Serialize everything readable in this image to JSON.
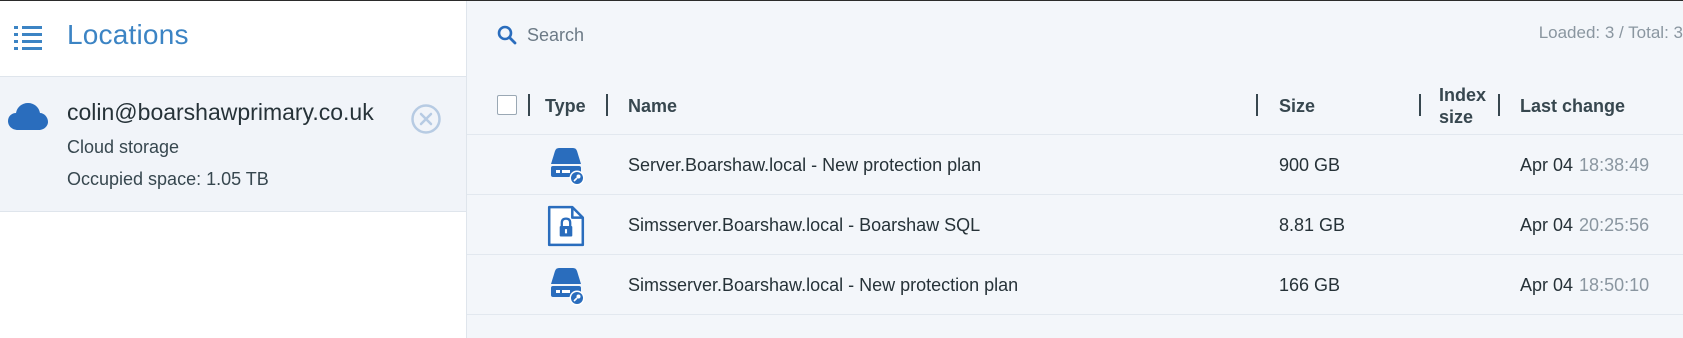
{
  "sidebar": {
    "title": "Locations",
    "menu_icon": "list-icon",
    "location": {
      "icon": "cloud-icon",
      "email": "colin@boarshawprimary.co.uk",
      "type": "Cloud storage",
      "occupied": "Occupied space: 1.05 TB",
      "remove_icon": "close-circle-icon"
    }
  },
  "toolbar": {
    "search_placeholder": "Search",
    "loaded_text": "Loaded: 3 / Total: 3"
  },
  "table": {
    "columns": {
      "type": "Type",
      "name": "Name",
      "size": "Size",
      "index_size_line1": "Index",
      "index_size_line2": "size",
      "last_change": "Last change"
    },
    "rows": [
      {
        "icon": "drive-key-icon",
        "name": "Server.Boarshaw.local - New protection plan",
        "size": "900 GB",
        "index_size": "",
        "date": "Apr 04",
        "time": "18:38:49"
      },
      {
        "icon": "file-lock-icon",
        "name": "Simsserver.Boarshaw.local - Boarshaw SQL",
        "size": "8.81 GB",
        "index_size": "",
        "date": "Apr 04",
        "time": "20:25:56"
      },
      {
        "icon": "drive-key-icon",
        "name": "Simsserver.Boarshaw.local - New protection plan",
        "size": "166 GB",
        "index_size": "",
        "date": "Apr 04",
        "time": "18:50:10"
      }
    ]
  },
  "colors": {
    "accent": "#3c84c4",
    "icon_blue": "#2a6dbd",
    "panel_bg": "#f3f6fa",
    "selected_bg": "#f1f4f9"
  }
}
